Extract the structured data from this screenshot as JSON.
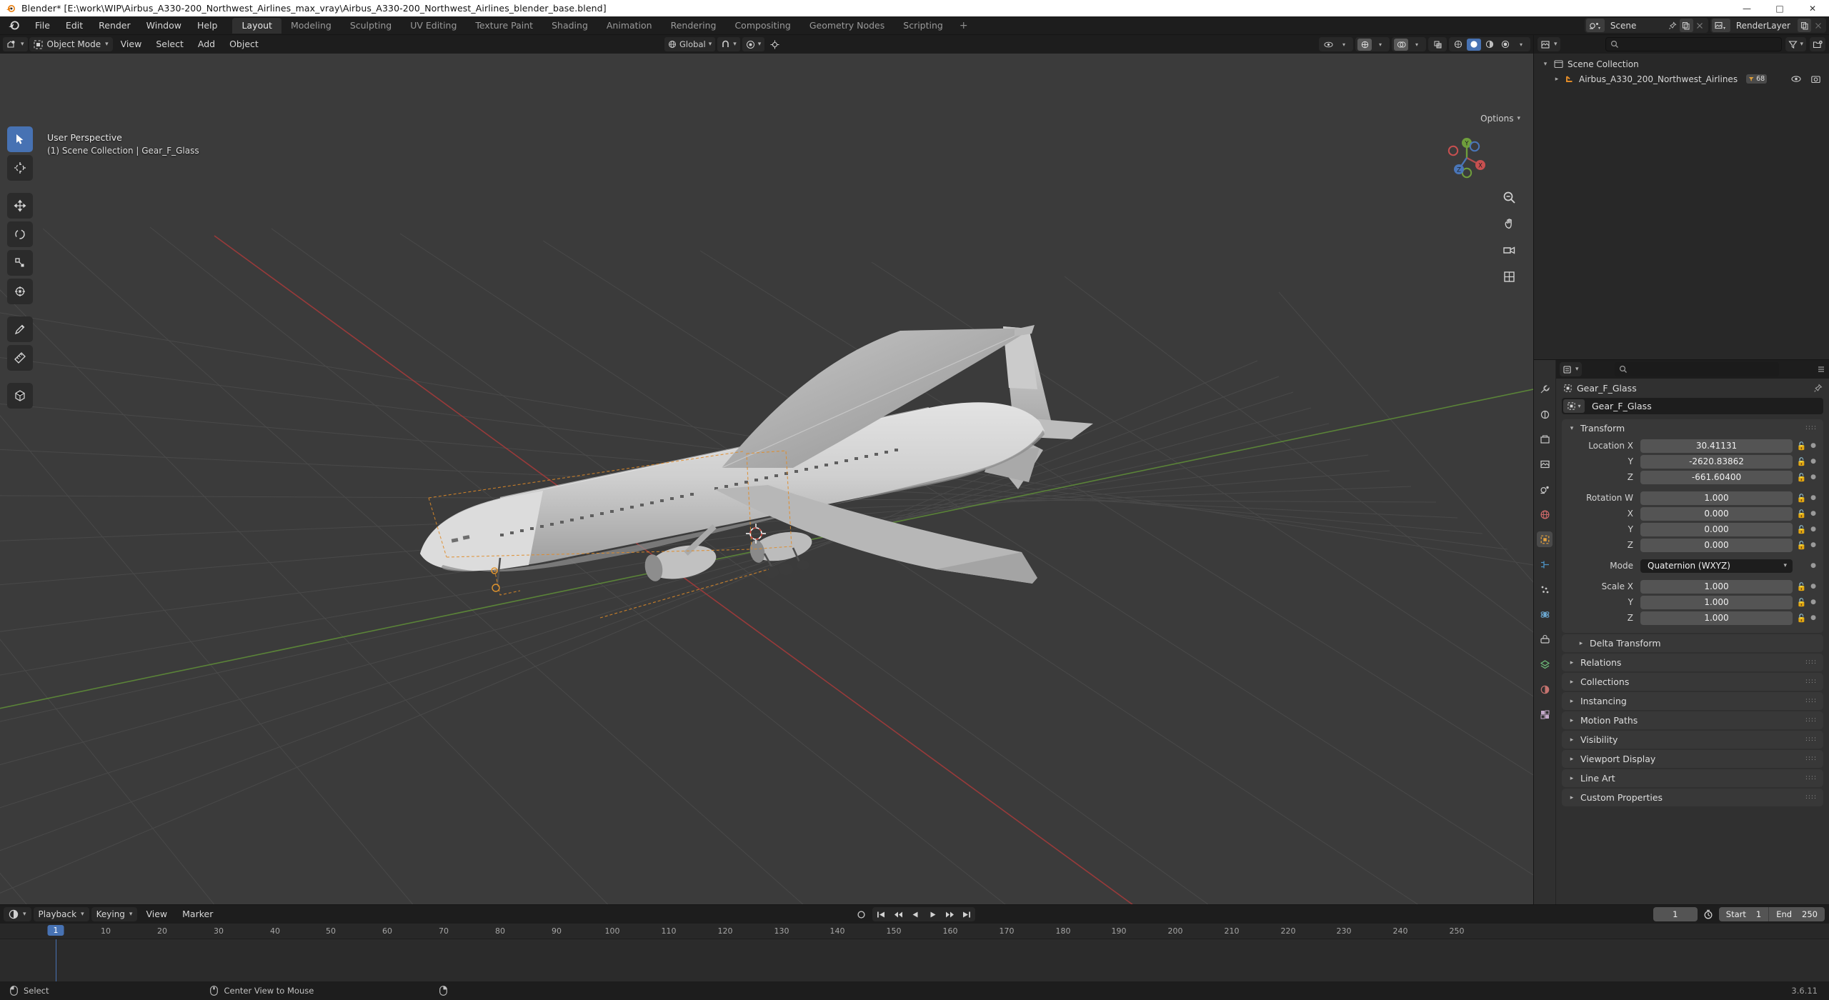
{
  "window": {
    "title": "Blender* [E:\\work\\WIP\\Airbus_A330-200_Northwest_Airlines_max_vray\\Airbus_A330-200_Northwest_Airlines_blender_base.blend]",
    "minimize": "—",
    "maximize": "□",
    "close": "✕"
  },
  "topbar": {
    "menus": [
      "File",
      "Edit",
      "Render",
      "Window",
      "Help"
    ],
    "workspaces": [
      {
        "label": "Layout",
        "active": true
      },
      {
        "label": "Modeling",
        "active": false
      },
      {
        "label": "Sculpting",
        "active": false
      },
      {
        "label": "UV Editing",
        "active": false
      },
      {
        "label": "Texture Paint",
        "active": false
      },
      {
        "label": "Shading",
        "active": false
      },
      {
        "label": "Animation",
        "active": false
      },
      {
        "label": "Rendering",
        "active": false
      },
      {
        "label": "Compositing",
        "active": false
      },
      {
        "label": "Geometry Nodes",
        "active": false
      },
      {
        "label": "Scripting",
        "active": false
      }
    ],
    "add_workspace": "+",
    "scene_name": "Scene",
    "view_layer_name": "RenderLayer"
  },
  "viewport": {
    "mode": "Object Mode",
    "menus": [
      "View",
      "Select",
      "Add",
      "Object"
    ],
    "transform_orientation": "Global",
    "options_label": "Options",
    "overlay_line1": "User Perspective",
    "overlay_line2": "(1) Scene Collection | Gear_F_Glass",
    "gizmo_axes": {
      "x": "X",
      "y": "Y",
      "z": "Z"
    }
  },
  "outliner": {
    "search_placeholder": "",
    "rows": [
      {
        "name": "Scene Collection",
        "indent": false,
        "triangle": "▾",
        "icon": "collection-icon",
        "badge": null,
        "eye": false
      },
      {
        "name": "Airbus_A330_200_Northwest_Airlines",
        "indent": true,
        "triangle": "▸",
        "icon": "empty-axes-icon",
        "badge": "68",
        "eye": true
      }
    ]
  },
  "properties": {
    "breadcrumb_object": "Gear_F_Glass",
    "id_name": "Gear_F_Glass",
    "transform_title": "Transform",
    "fields": [
      {
        "label": "Location X",
        "value": "30.41131",
        "type": "num"
      },
      {
        "label": "Y",
        "value": "-2620.83862",
        "type": "num"
      },
      {
        "label": "Z",
        "value": "-661.60400",
        "type": "num"
      },
      {
        "label": "Rotation W",
        "value": "1.000",
        "type": "num",
        "gap_before": true
      },
      {
        "label": "X",
        "value": "0.000",
        "type": "num"
      },
      {
        "label": "Y",
        "value": "0.000",
        "type": "num"
      },
      {
        "label": "Z",
        "value": "0.000",
        "type": "num"
      },
      {
        "label": "Mode",
        "value": "Quaternion (WXYZ)",
        "type": "enum",
        "gap_before": true
      },
      {
        "label": "Scale X",
        "value": "1.000",
        "type": "num",
        "gap_before": true
      },
      {
        "label": "Y",
        "value": "1.000",
        "type": "num"
      },
      {
        "label": "Z",
        "value": "1.000",
        "type": "num"
      }
    ],
    "sub_panel": "Delta Transform",
    "collapsed_panels": [
      "Relations",
      "Collections",
      "Instancing",
      "Motion Paths",
      "Visibility",
      "Viewport Display",
      "Line Art",
      "Custom Properties"
    ]
  },
  "timeline": {
    "menus": [
      "View",
      "Marker"
    ],
    "dropdowns": [
      "Playback",
      "Keying"
    ],
    "current_frame": "1",
    "start_label": "Start",
    "start_value": "1",
    "end_label": "End",
    "end_value": "250",
    "ticks": [
      "10",
      "20",
      "30",
      "40",
      "50",
      "60",
      "70",
      "80",
      "90",
      "100",
      "110",
      "120",
      "130",
      "140",
      "150",
      "160",
      "170",
      "180",
      "190",
      "200",
      "210",
      "220",
      "230",
      "240",
      "250"
    ],
    "playhead_frame": "1"
  },
  "statusbar": {
    "items": [
      {
        "icon": "mouse-left-icon",
        "label": "Select"
      },
      {
        "icon": "mouse-middle-icon",
        "label": "Center View to Mouse"
      },
      {
        "icon": "mouse-right-icon",
        "label": ""
      }
    ],
    "version": "3.6.11"
  },
  "colors": {
    "accent": "#4772b3",
    "header": "#1d1d1d",
    "panel": "#383838",
    "viewport_bg": "#3b3b3b",
    "field": "#545454",
    "axis_x": "#a33b3b",
    "axis_y": "#5d8a38"
  }
}
